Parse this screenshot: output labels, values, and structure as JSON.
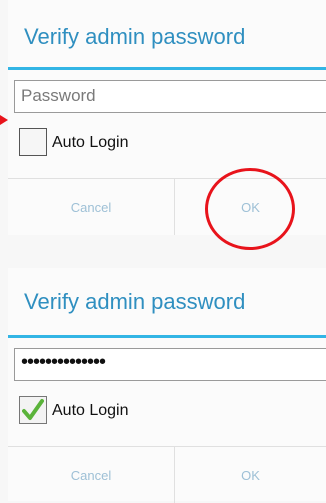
{
  "dialog_before": {
    "title": "Verify admin password",
    "password_placeholder": "Password",
    "auto_login_label": "Auto Login",
    "auto_login_checked": false,
    "cancel_label": "Cancel",
    "ok_label": "OK"
  },
  "dialog_after": {
    "title": "Verify admin password",
    "password_value": "••••••••••••••",
    "auto_login_label": "Auto Login",
    "auto_login_checked": true,
    "cancel_label": "Cancel",
    "ok_label": "OK"
  },
  "colors": {
    "title": "#2f8fc0",
    "divider": "#33b5e5",
    "button_text": "#9ec0d6",
    "annotation": "#e8131b",
    "checkmark": "#5ab33a"
  }
}
